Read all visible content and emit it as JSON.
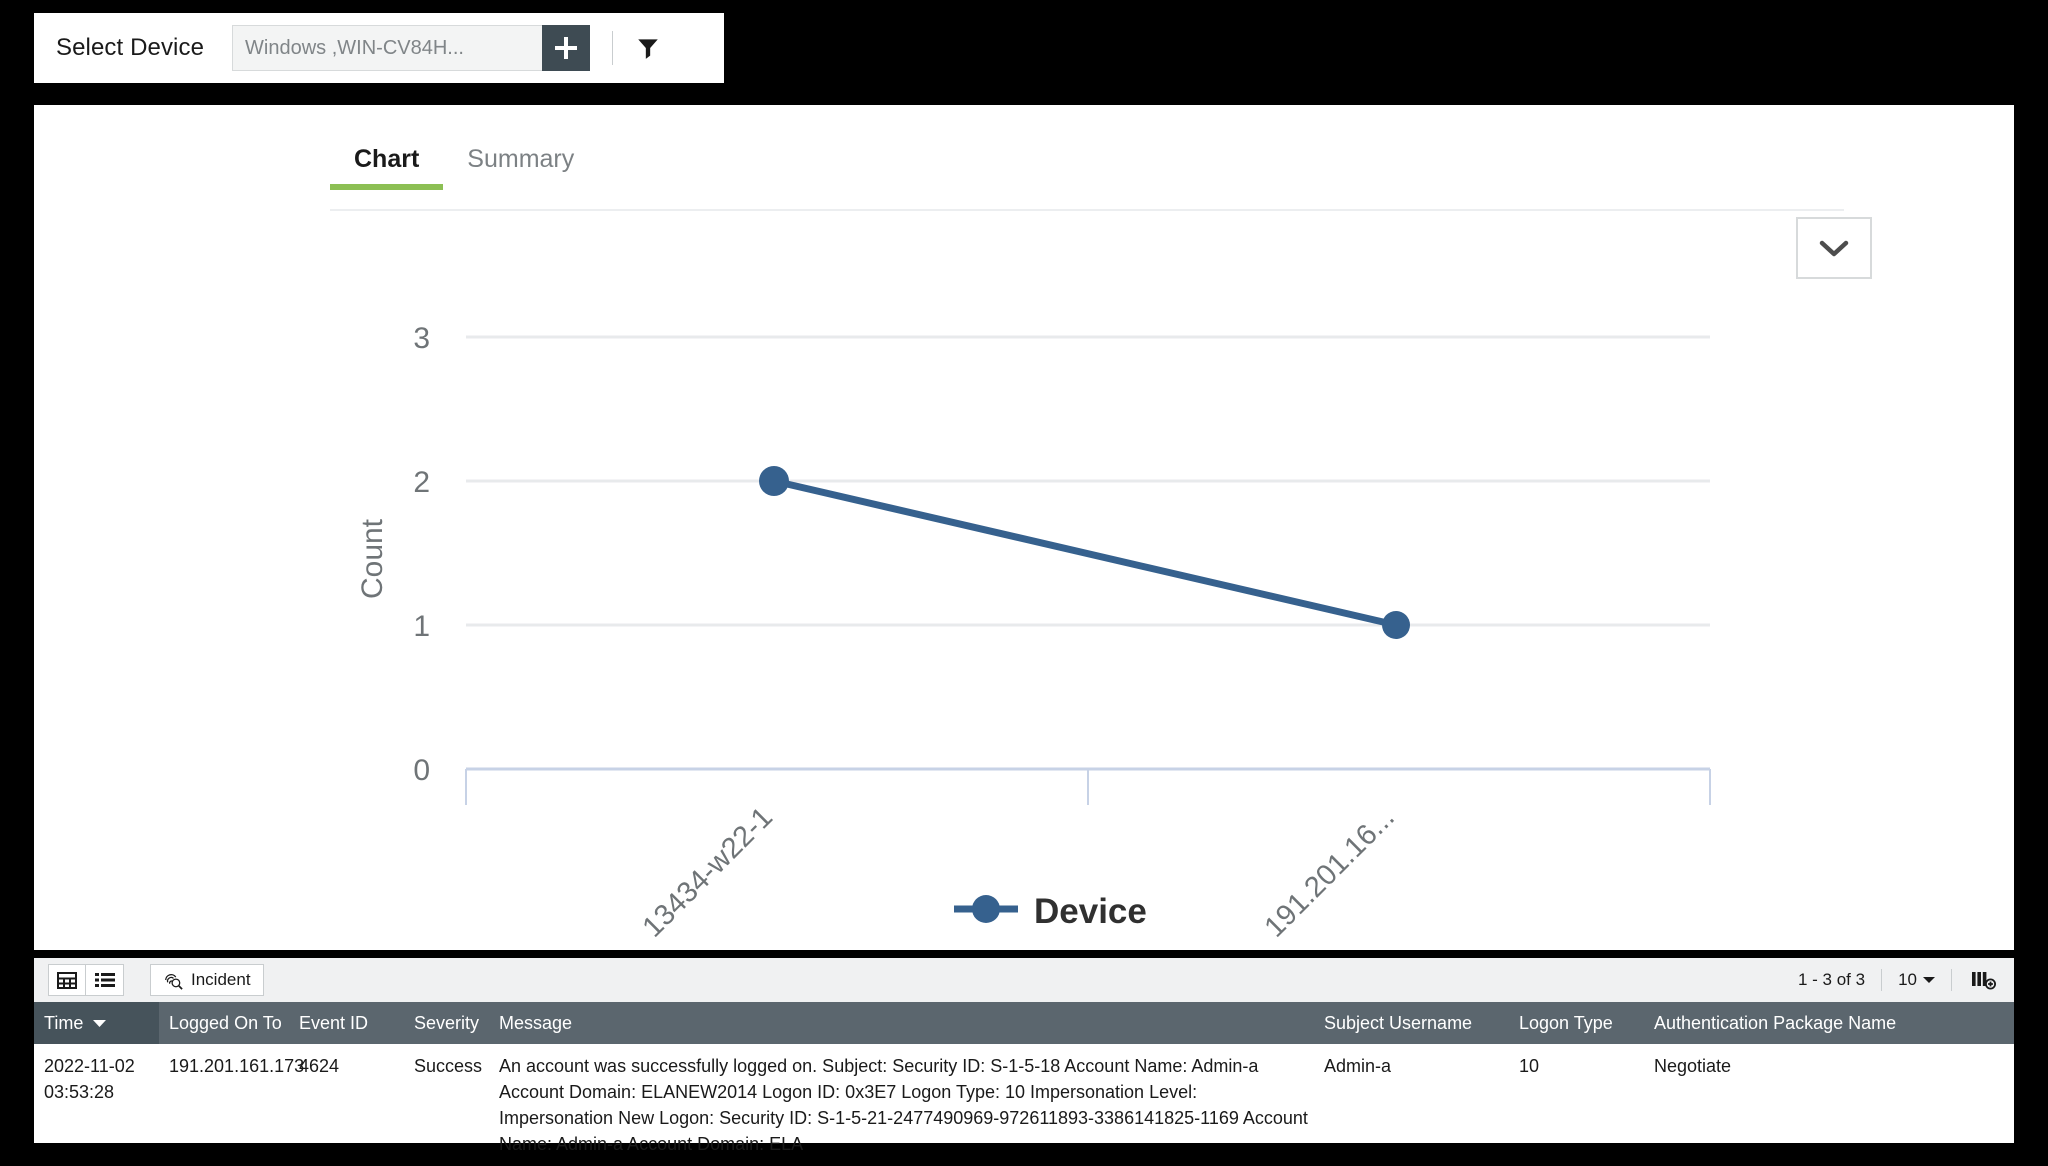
{
  "device_bar": {
    "label": "Select Device",
    "input_value": "Windows ,WIN-CV84H...",
    "input_placeholder": "Windows ,WIN-CV84H...",
    "add_icon": "plus-icon",
    "filter_icon": "funnel-filter-icon"
  },
  "tabs": [
    {
      "label": "Chart",
      "active": true
    },
    {
      "label": "Summary",
      "active": false
    }
  ],
  "chart_panel": {
    "expand_icon": "chevron-down-icon"
  },
  "chart_data": {
    "type": "line",
    "title": "",
    "xlabel": "",
    "ylabel": "Count",
    "categories": [
      "13434-w22-1",
      "191.201.16..."
    ],
    "series": [
      {
        "name": "Device",
        "values": [
          2,
          1
        ],
        "color": "#36618E"
      }
    ],
    "yticks": [
      3,
      2,
      1,
      0
    ],
    "ylim": [
      0,
      3
    ],
    "grid": true,
    "legend_position": "bottom",
    "legend": [
      "Device"
    ],
    "xtick_rotation": -45
  },
  "table": {
    "toolbar": {
      "grid_view_icon": "grid-view-icon",
      "list_view_icon": "list-view-icon",
      "incident_label": "Incident",
      "incident_icon": "fingerprint-search-icon",
      "page_range": "1 - 3 of 3",
      "page_size": "10",
      "page_size_icon": "chevron-down-icon",
      "column_config_icon": "add-column-icon"
    },
    "columns": [
      {
        "label": "Time",
        "sorted": true,
        "sort_icon": "sort-desc-icon"
      },
      {
        "label": "Logged On To",
        "sorted": false
      },
      {
        "label": "Event ID",
        "sorted": false
      },
      {
        "label": "Severity",
        "sorted": false
      },
      {
        "label": "Message",
        "sorted": false
      },
      {
        "label": "Subject Username",
        "sorted": false
      },
      {
        "label": "Logon Type",
        "sorted": false
      },
      {
        "label": "Authentication Package Name",
        "sorted": false
      }
    ],
    "rows": [
      {
        "time": "2022-11-02\n03:53:28",
        "logged_on_to": "191.201.161.173",
        "event_id": "4624",
        "severity": "Success",
        "message": "An account was successfully logged on. Subject: Security ID: S-1-5-18 Account Name: Admin-a Account Domain: ELANEW2014 Logon ID: 0x3E7 Logon Type: 10 Impersonation Level: Impersonation New Logon: Security ID: S-1-5-21-2477490969-972611893-3386141825-1169 Account Name: Admin-a Account Domain: ELA",
        "subject_username": "Admin-a",
        "logon_type": "10",
        "auth_package_name": "Negotiate"
      }
    ]
  }
}
